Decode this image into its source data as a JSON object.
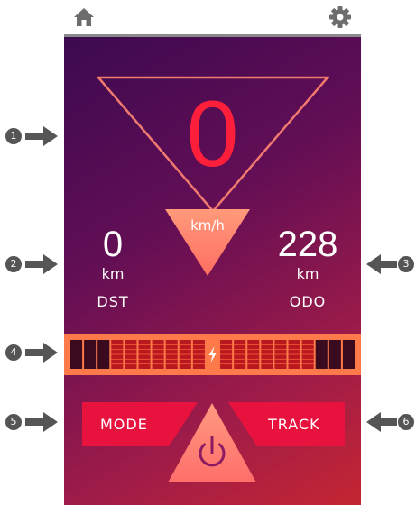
{
  "top_bar": {
    "home_icon": "home-icon",
    "settings_icon": "gear-icon"
  },
  "speedometer": {
    "speed": "0",
    "unit": "km/h"
  },
  "distance": {
    "value": "0",
    "unit": "km",
    "label": "DST"
  },
  "odometer": {
    "value": "228",
    "unit": "km",
    "label": "ODO"
  },
  "battery_bar": {
    "icon": "lightning-icon",
    "segments_lit": "low-end and high-end dark, middle segments red"
  },
  "buttons": {
    "mode_label": "MODE",
    "track_label": "TRACK",
    "power_icon": "power-icon"
  },
  "callouts": [
    "1",
    "2",
    "3",
    "4",
    "5",
    "6"
  ],
  "colors": {
    "accent": "#ff1f3a",
    "button": "#e8123f",
    "battery": "#ff7a4a",
    "panel_top": "#3c0a4f",
    "panel_bottom": "#c42632"
  }
}
